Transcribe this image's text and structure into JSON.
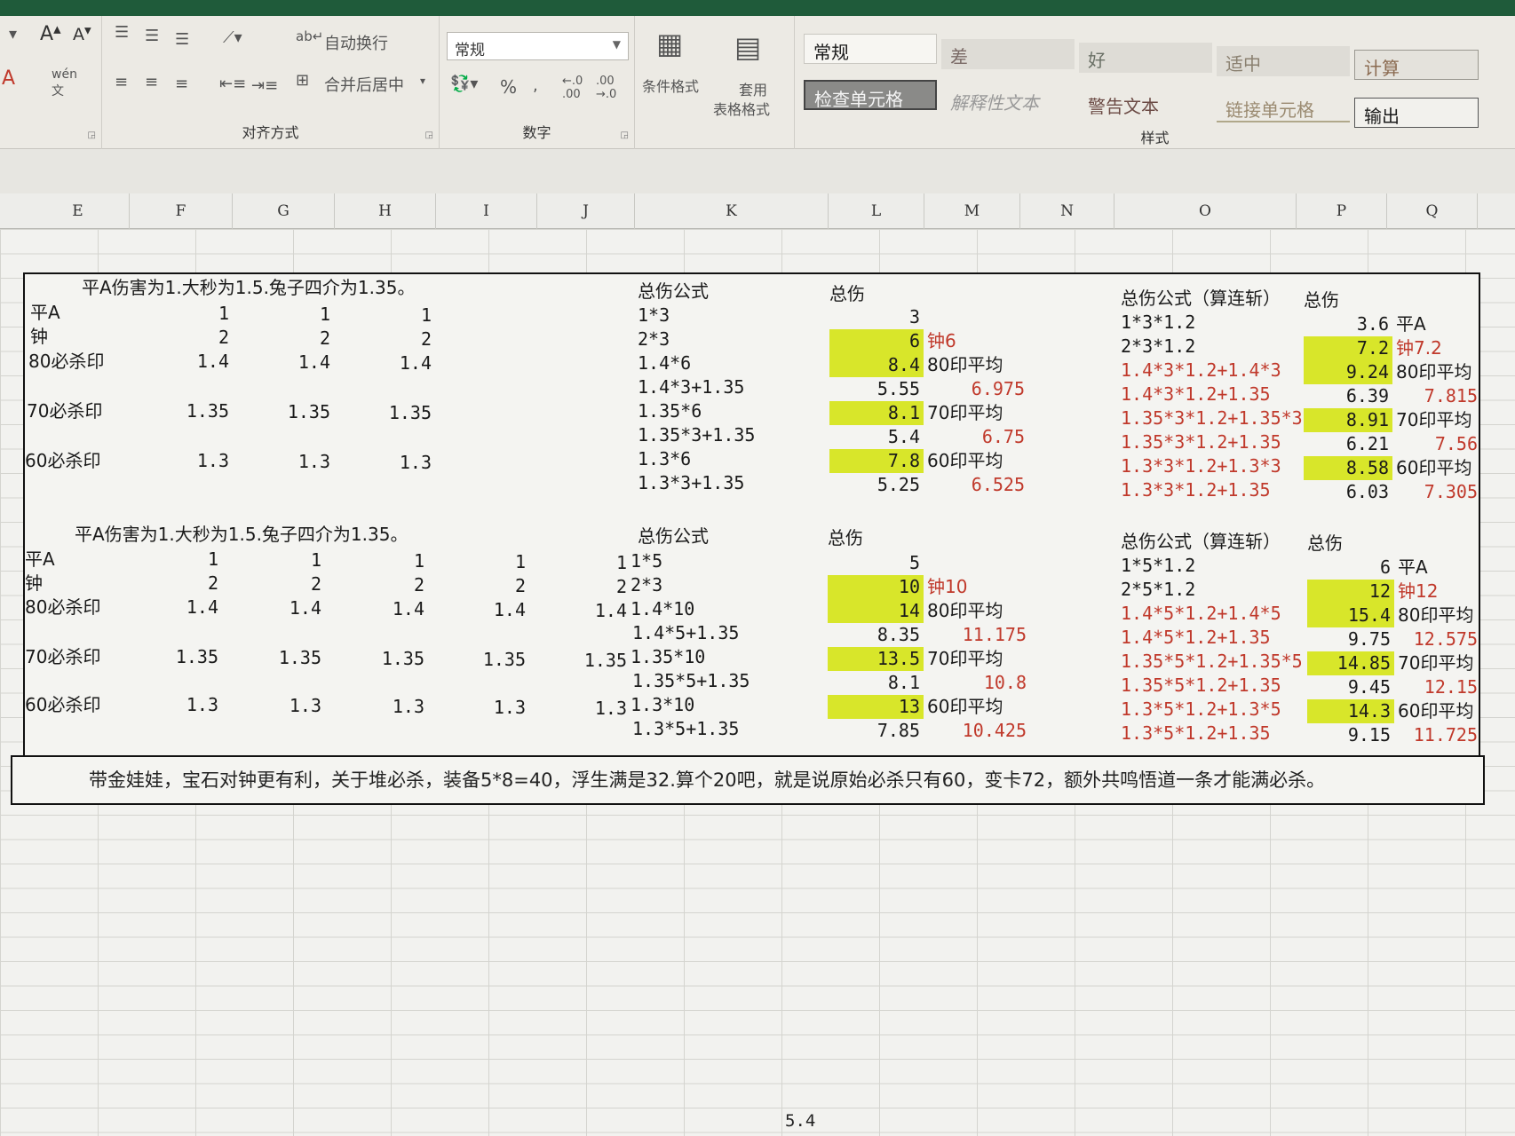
{
  "ribbon": {
    "wrap_text": "自动换行",
    "merge_center": "合并后居中",
    "align_label": "对齐方式",
    "number_format": "常规",
    "number_label": "数字",
    "percent": "%",
    "cond_format": "条件格式",
    "table_format_1": "套用",
    "table_format_2": "表格格式",
    "styles_label": "样式",
    "styles": {
      "normal": "常规",
      "bad": "差",
      "good": "好",
      "neutral": "适中",
      "calc": "计算",
      "check_cell": "检查单元格",
      "explain": "解释性文本",
      "warning": "警告文本",
      "linked": "链接单元格",
      "output": "输出"
    }
  },
  "columns": [
    "E",
    "F",
    "G",
    "H",
    "I",
    "J",
    "K",
    "L",
    "M",
    "N",
    "O",
    "P",
    "Q"
  ],
  "section1": {
    "title": "平A伤害为1.大秒为1.5.兔子四介为1.35。",
    "rows": [
      {
        "label": "平A",
        "vals": [
          "1",
          "1",
          "1"
        ]
      },
      {
        "label": "钟",
        "vals": [
          "2",
          "2",
          "2"
        ]
      },
      {
        "label": "80必杀印",
        "vals": [
          "1.4",
          "1.4",
          "1.4"
        ]
      },
      {
        "label": "70必杀印",
        "vals": [
          "1.35",
          "1.35",
          "1.35"
        ]
      },
      {
        "label": "60必杀印",
        "vals": [
          "1.3",
          "1.3",
          "1.3"
        ]
      }
    ],
    "formula_header": "总伤公式",
    "total_header": "总伤",
    "formulas": [
      "1*3",
      "2*3",
      "1.4*6",
      "1.4*3+1.35",
      "1.35*6",
      "1.35*3+1.35",
      "1.3*6",
      "1.3*3+1.35"
    ],
    "totals": [
      "3",
      "6",
      "8.4",
      "5.55",
      "8.1",
      "5.4",
      "7.8",
      "5.25"
    ],
    "m_col": [
      "",
      "钟6",
      "80印平均",
      "6.975",
      "70印平均",
      "6.75",
      "60印平均",
      "6.525"
    ],
    "formula2_header": "总伤公式（算连斩）",
    "total2_header": "总伤",
    "formulas2": [
      "1*3*1.2",
      "2*3*1.2",
      "1.4*3*1.2+1.4*3",
      "1.4*3*1.2+1.35",
      "1.35*3*1.2+1.35*3",
      "1.35*3*1.2+1.35",
      "1.3*3*1.2+1.3*3",
      "1.3*3*1.2+1.35"
    ],
    "totals2": [
      "3.6",
      "7.2",
      "9.24",
      "6.39",
      "8.91",
      "6.21",
      "8.58",
      "6.03"
    ],
    "q_col": [
      "平A",
      "钟7.2",
      "80印平均",
      "7.815",
      "70印平均",
      "7.56",
      "60印平均",
      "7.305"
    ]
  },
  "section2": {
    "title": "平A伤害为1.大秒为1.5.兔子四介为1.35。",
    "rows": [
      {
        "label": "平A",
        "vals": [
          "1",
          "1",
          "1",
          "1",
          "1"
        ]
      },
      {
        "label": "钟",
        "vals": [
          "2",
          "2",
          "2",
          "2",
          "2"
        ]
      },
      {
        "label": "80必杀印",
        "vals": [
          "1.4",
          "1.4",
          "1.4",
          "1.4",
          "1.4"
        ]
      },
      {
        "label": "70必杀印",
        "vals": [
          "1.35",
          "1.35",
          "1.35",
          "1.35",
          "1.35"
        ]
      },
      {
        "label": "60必杀印",
        "vals": [
          "1.3",
          "1.3",
          "1.3",
          "1.3",
          "1.3"
        ]
      }
    ],
    "formula_header": "总伤公式",
    "total_header": "总伤",
    "formulas": [
      "1*5",
      "2*3",
      "1.4*10",
      "1.4*5+1.35",
      "1.35*10",
      "1.35*5+1.35",
      "1.3*10",
      "1.3*5+1.35"
    ],
    "totals": [
      "5",
      "10",
      "14",
      "8.35",
      "13.5",
      "8.1",
      "13",
      "7.85"
    ],
    "m_col": [
      "",
      "钟10",
      "80印平均",
      "11.175",
      "70印平均",
      "10.8",
      "60印平均",
      "10.425"
    ],
    "formula2_header": "总伤公式（算连斩）",
    "total2_header": "总伤",
    "formulas2": [
      "1*5*1.2",
      "2*5*1.2",
      "1.4*5*1.2+1.4*5",
      "1.4*5*1.2+1.35",
      "1.35*5*1.2+1.35*5",
      "1.35*5*1.2+1.35",
      "1.3*5*1.2+1.3*5",
      "1.3*5*1.2+1.35"
    ],
    "totals2": [
      "6",
      "12",
      "15.4",
      "9.75",
      "14.85",
      "9.45",
      "14.3",
      "9.15"
    ],
    "q_col": [
      "平A",
      "钟12",
      "80印平均",
      "12.575",
      "70印平均",
      "12.15",
      "60印平均",
      "11.725"
    ]
  },
  "note": "带金娃娃，宝石对钟更有利，关于堆必杀，装备5*8=40，浮生满是32.算个20吧，就是说原始必杀只有60，变卡72，额外共鸣悟道一条才能满必杀。",
  "status_value": "5.4",
  "colors": {
    "highlight": "#d8e62a",
    "red_text": "#c0392b"
  }
}
